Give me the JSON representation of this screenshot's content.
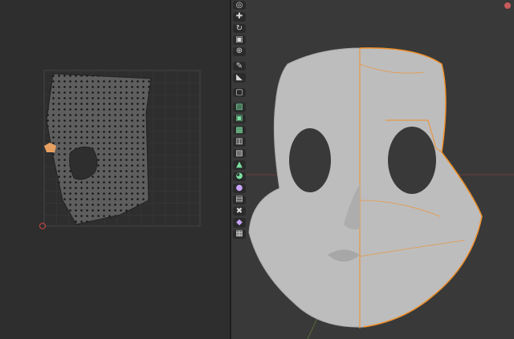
{
  "uv_editor": {
    "grid_color": "#3a3a3a",
    "island_color": "#5e5e5e",
    "selected_color": "#e8a060"
  },
  "toolbar": {
    "tools": [
      {
        "icon": "cursor-icon",
        "glyph": "◎"
      },
      {
        "icon": "move-icon",
        "glyph": "✚"
      },
      {
        "icon": "rotate-icon",
        "glyph": "↻"
      },
      {
        "icon": "scale-icon",
        "glyph": "▣"
      },
      {
        "icon": "transform-icon",
        "glyph": "⊕"
      },
      {
        "icon": "annotate-icon",
        "glyph": "✎"
      },
      {
        "icon": "measure-icon",
        "glyph": "◣"
      },
      {
        "icon": "add-cube-icon",
        "glyph": "▢"
      },
      {
        "icon": "extrude-icon",
        "glyph": "▨"
      },
      {
        "icon": "inset-icon",
        "glyph": "▣"
      },
      {
        "icon": "bevel-icon",
        "glyph": "▩"
      },
      {
        "icon": "loop-cut-icon",
        "glyph": "▥"
      },
      {
        "icon": "knife-icon",
        "glyph": "▧"
      },
      {
        "icon": "poly-build-icon",
        "glyph": "▲"
      },
      {
        "icon": "spin-icon",
        "glyph": "◕"
      },
      {
        "icon": "smooth-icon",
        "glyph": "●"
      },
      {
        "icon": "edge-slide-icon",
        "glyph": "▤"
      },
      {
        "icon": "shrink-fatten-icon",
        "glyph": "✖"
      },
      {
        "icon": "shear-icon",
        "glyph": "◆"
      },
      {
        "icon": "rip-region-icon",
        "glyph": "▦"
      }
    ]
  },
  "colors": {
    "selection_orange": "#f0902a",
    "mesh_gray": "#bdbdbd"
  }
}
